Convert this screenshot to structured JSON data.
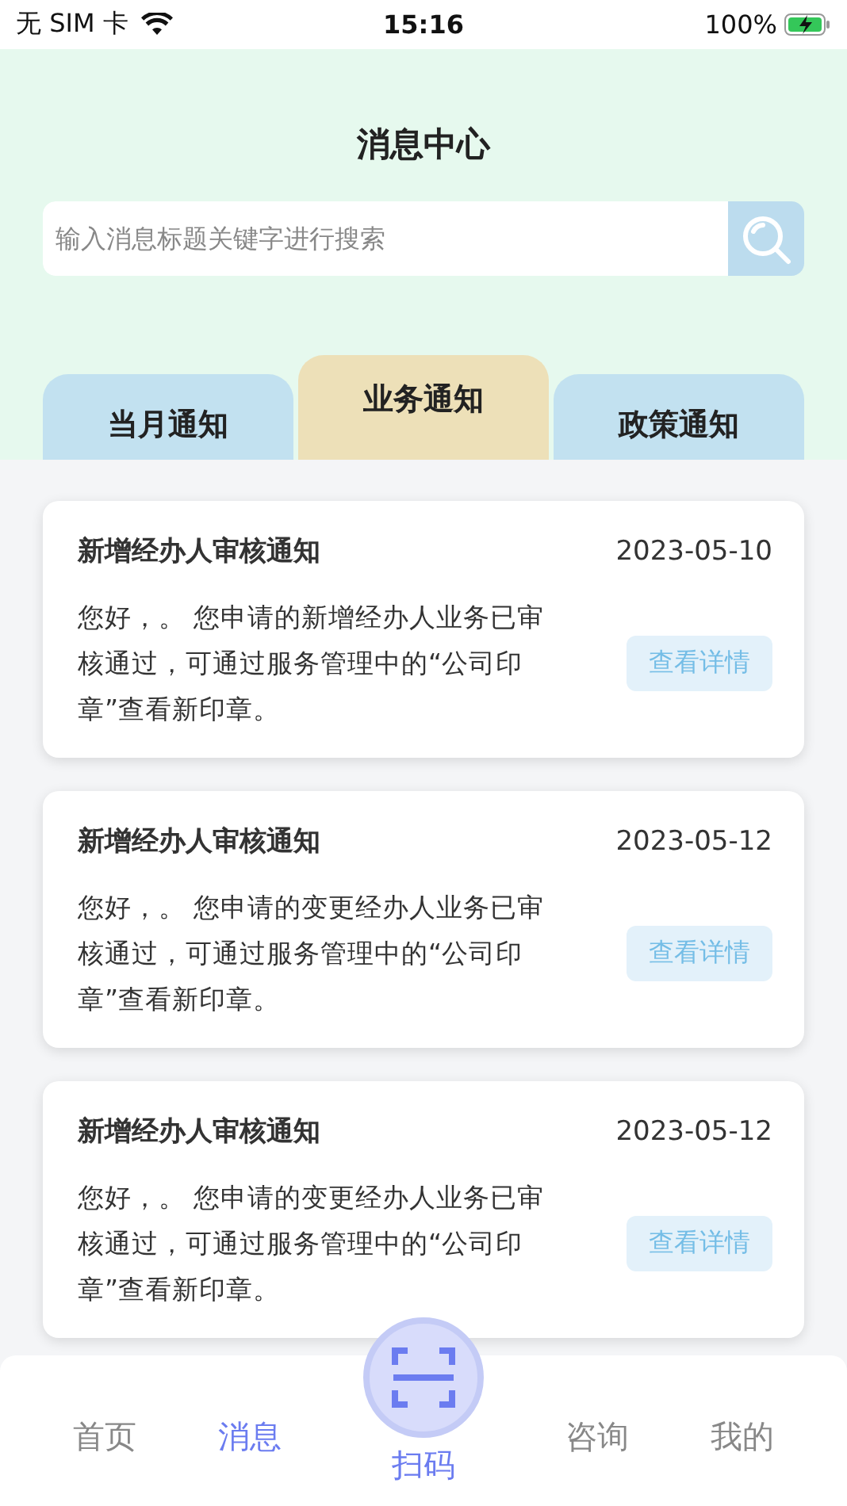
{
  "status_bar": {
    "carrier": "无 SIM 卡",
    "time": "15:16",
    "battery": "100%"
  },
  "header": {
    "title": "消息中心"
  },
  "search": {
    "placeholder": "输入消息标题关键字进行搜索"
  },
  "tabs": [
    {
      "label": "当月通知",
      "selected": false
    },
    {
      "label": "业务通知",
      "selected": true
    },
    {
      "label": "政策通知",
      "selected": false
    }
  ],
  "messages": [
    {
      "title": "新增经办人审核通知",
      "date": "2023-05-10",
      "body": "您好，。 您申请的新增经办人业务已审核通过，可通过服务管理中的“公司印章”查看新印章。",
      "button": "查看详情"
    },
    {
      "title": "新增经办人审核通知",
      "date": "2023-05-12",
      "body": "您好，。 您申请的变更经办人业务已审核通过，可通过服务管理中的“公司印章”查看新印章。",
      "button": "查看详情"
    },
    {
      "title": "新增经办人审核通知",
      "date": "2023-05-12",
      "body": "您好，。 您申请的变更经办人业务已审核通过，可通过服务管理中的“公司印章”查看新印章。",
      "button": "查看详情"
    }
  ],
  "nav": [
    {
      "kind": "tab",
      "label": "首页",
      "selected": false
    },
    {
      "kind": "tab",
      "label": "消息",
      "selected": true
    },
    {
      "kind": "scan",
      "label": "扫码",
      "selected": true
    },
    {
      "kind": "tab",
      "label": "咨询",
      "selected": false
    },
    {
      "kind": "tab",
      "label": "我的",
      "selected": false
    }
  ]
}
